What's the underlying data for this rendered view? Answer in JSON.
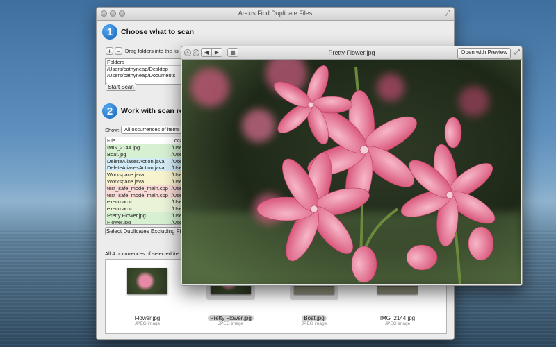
{
  "main_window": {
    "title": "Araxis Find Duplicate Files",
    "step1": {
      "number": "1",
      "title": "Choose what to scan"
    },
    "add_button": "+",
    "remove_button": "−",
    "drag_hint": "Drag folders into the lis",
    "folders": {
      "header": "Folders",
      "rows": [
        "/Users/cathyneap/Desktop",
        "/Users/cathyneap/Documents"
      ]
    },
    "start_scan_label": "Start Scan",
    "step2": {
      "number": "2",
      "title": "Work with scan res"
    },
    "show_label": "Show:",
    "show_value": "All occurrences of items",
    "table": {
      "headers": [
        "File",
        "Loca"
      ],
      "rows": [
        {
          "name": "IMG_2144.jpg",
          "loc": "/Use",
          "color": "#d7f0d2"
        },
        {
          "name": "Boat.jpg",
          "loc": "/Use",
          "color": "#d7f0d2"
        },
        {
          "name": "DeleteAliasesAction.java",
          "loc": "/Use",
          "color": "#d4ecf6"
        },
        {
          "name": "DeleteAliasesAction.java",
          "loc": "/Use",
          "color": "#d4ecf6"
        },
        {
          "name": "Workspace.java",
          "loc": "/Use",
          "color": "#f7f3cf"
        },
        {
          "name": "Workspace.java",
          "loc": "/Use",
          "color": "#f7f3cf"
        },
        {
          "name": "test_safe_mode_main.cpp",
          "loc": "/Use",
          "color": "#f8dad6"
        },
        {
          "name": "test_safe_mode_main.cpp",
          "loc": "/Use",
          "color": "#f8dad6"
        },
        {
          "name": "execmac.c",
          "loc": "/Use",
          "color": "#eaf2d8"
        },
        {
          "name": "execmac.c",
          "loc": "/Use",
          "color": "#eaf2d8"
        },
        {
          "name": "Pretty Flower.jpg",
          "loc": "/Use",
          "color": "#d7f0d2"
        },
        {
          "name": "Flower.jpg",
          "loc": "/Use",
          "color": "#d7f0d2"
        }
      ]
    },
    "select_dupes_label": "Select Duplicates Excluding Firs",
    "occurrences_label": "All 4 occurrences of selected ite",
    "thumbnails": [
      {
        "name": "Flower.jpg",
        "kind": "JPEG image",
        "selected": false,
        "img": "flower"
      },
      {
        "name": "Pretty Flower.jpg",
        "kind": "JPEG image",
        "selected": true,
        "img": "flower"
      },
      {
        "name": "Boat.jpg",
        "kind": "JPEG image",
        "selected": true,
        "img": "boat"
      },
      {
        "name": "IMG_2144.jpg",
        "kind": "JPEG image",
        "selected": false,
        "img": "boat"
      }
    ]
  },
  "quicklook": {
    "title": "Pretty Flower.jpg",
    "open_button": "Open with Preview",
    "close_glyph": "×",
    "fullscreen_glyph": "⤢",
    "prev_glyph": "◀",
    "next_glyph": "▶",
    "grid_glyph": "▦"
  }
}
